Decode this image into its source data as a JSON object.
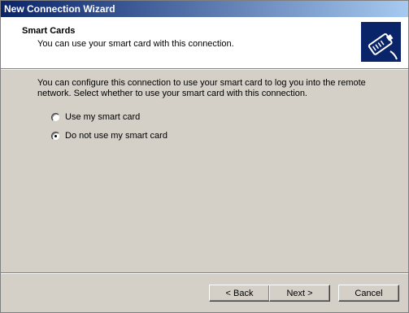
{
  "window": {
    "title": "New Connection Wizard"
  },
  "header": {
    "title": "Smart Cards",
    "subtitle": "You can use your smart card with this connection.",
    "icon": "smart-card-icon"
  },
  "body": {
    "description": "You can configure this connection to use your smart card to log you into the remote network.  Select whether to use your smart card with this connection."
  },
  "options": [
    {
      "label": "Use my smart card",
      "selected": false
    },
    {
      "label": "Do not use my smart card",
      "selected": true
    }
  ],
  "buttons": {
    "back": "< Back",
    "next": "Next >",
    "cancel": "Cancel"
  }
}
